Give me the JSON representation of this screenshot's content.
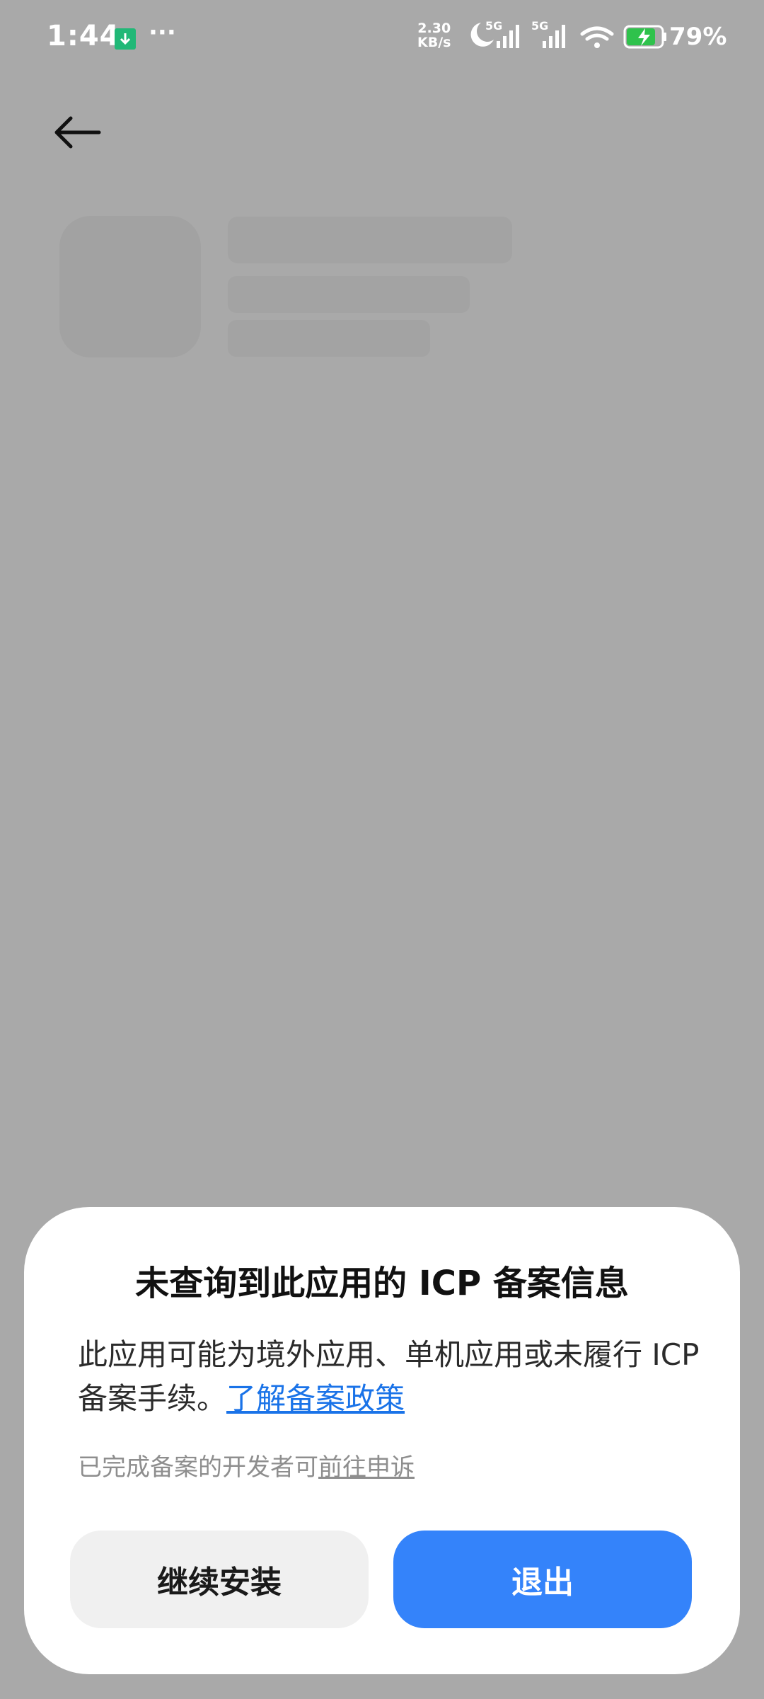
{
  "status_bar": {
    "time": "1:44",
    "net_speed_value": "2.30",
    "net_speed_unit": "KB/s",
    "signal_1_label": "5G",
    "signal_2_label": "5G",
    "battery_percent": "79%",
    "icons": [
      "download-notification-icon",
      "more-dots-icon",
      "moon-icon",
      "signal-icon",
      "signal-icon",
      "wifi-icon",
      "battery-charging-icon"
    ]
  },
  "dialog": {
    "title": "未查询到此应用的 ICP 备案信息",
    "body_text": "此应用可能为境外应用、单机应用或未履行 ICP 备案手续。",
    "policy_link": "了解备案政策",
    "note_text": "已完成备案的开发者可",
    "note_link": "前往申诉",
    "continue_button": "继续安装",
    "exit_button": "退出"
  },
  "colors": {
    "overlay": "#a9a9a9",
    "link": "#1a73e8",
    "primary_button": "#3483fa",
    "secondary_button": "#f0f0f0"
  }
}
